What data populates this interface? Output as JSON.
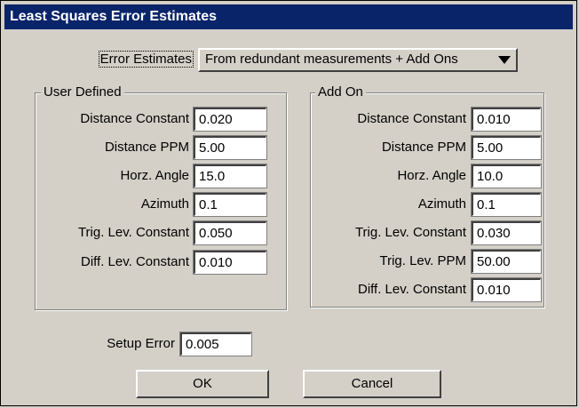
{
  "window": {
    "title": "Least Squares Error Estimates"
  },
  "estimates": {
    "label": "Error Estimates",
    "selected": "From redundant measurements + Add Ons"
  },
  "user_defined": {
    "title": "User Defined",
    "rows": [
      {
        "label": "Distance Constant",
        "value": "0.020"
      },
      {
        "label": "Distance PPM",
        "value": "5.00"
      },
      {
        "label": "Horz. Angle",
        "value": "15.0"
      },
      {
        "label": "Azimuth",
        "value": "0.1"
      },
      {
        "label": "Trig. Lev. Constant",
        "value": "0.050"
      },
      {
        "label": "Diff. Lev. Constant",
        "value": "0.010"
      }
    ]
  },
  "add_on": {
    "title": "Add On",
    "rows": [
      {
        "label": "Distance Constant",
        "value": "0.010"
      },
      {
        "label": "Distance PPM",
        "value": "5.00"
      },
      {
        "label": "Horz. Angle",
        "value": "10.0"
      },
      {
        "label": "Azimuth",
        "value": "0.1"
      },
      {
        "label": "Trig. Lev. Constant",
        "value": "0.030"
      },
      {
        "label": "Trig. Lev. PPM",
        "value": "50.00"
      },
      {
        "label": "Diff. Lev. Constant",
        "value": "0.010"
      }
    ]
  },
  "setup_error": {
    "label": "Setup Error",
    "value": "0.005"
  },
  "buttons": {
    "ok": "OK",
    "cancel": "Cancel"
  }
}
